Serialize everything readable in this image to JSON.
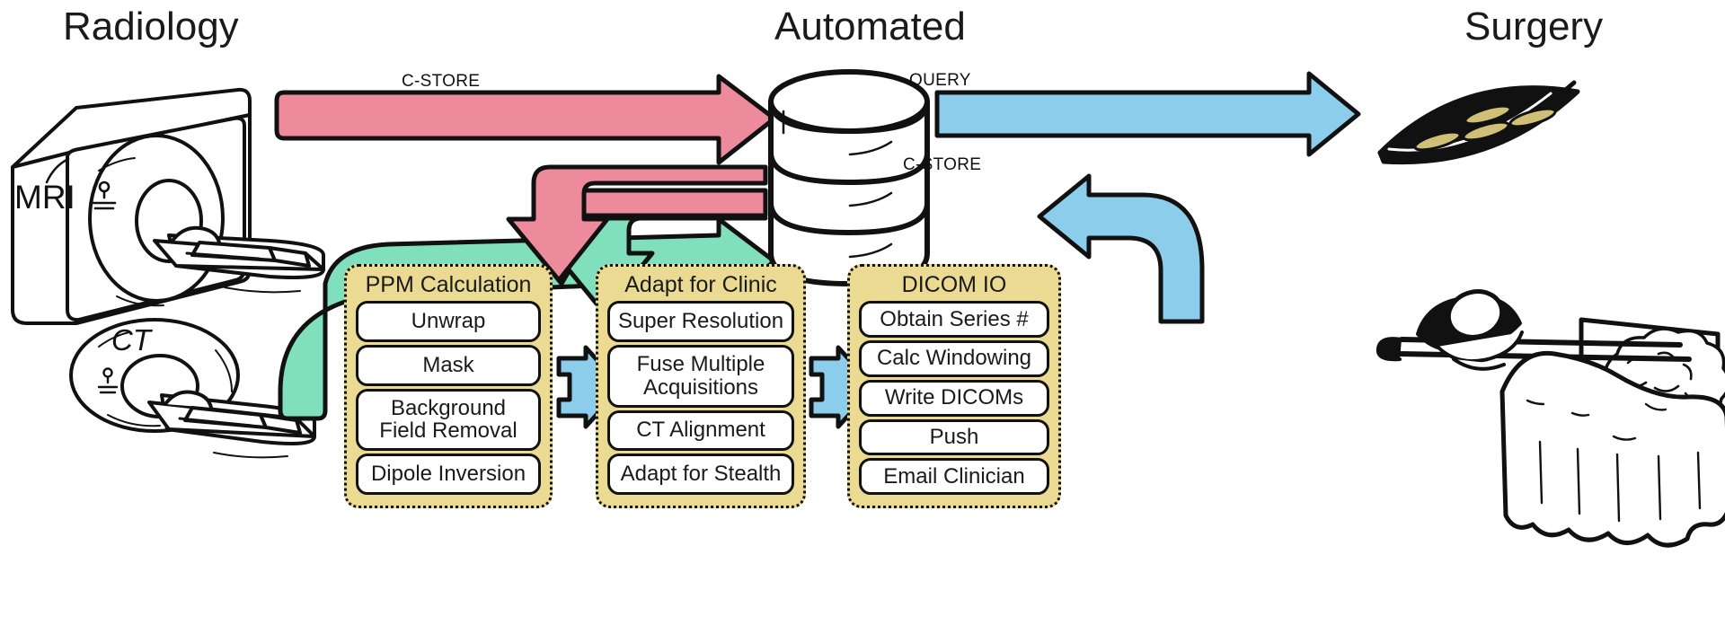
{
  "headings": {
    "radiology": "Radiology",
    "automated": "Automated",
    "surgery": "Surgery"
  },
  "equipment": {
    "mri_label": "MRI",
    "ct_label": "CT"
  },
  "arrow_labels": {
    "cstore_in": "C-STORE",
    "query": "QUERY",
    "cstore_back": "C-STORE"
  },
  "groups": [
    {
      "id": "ppm",
      "title": "PPM Calculation",
      "steps": [
        {
          "label": "Unwrap"
        },
        {
          "label": "Mask"
        },
        {
          "label": "Background\nField Removal"
        },
        {
          "label": "Dipole Inversion"
        }
      ]
    },
    {
      "id": "clinic",
      "title": "Adapt for Clinic",
      "steps": [
        {
          "label": "Super Resolution"
        },
        {
          "label": "Fuse Multiple\nAcquisitions"
        },
        {
          "label": "CT Alignment"
        },
        {
          "label": "Adapt for Stealth"
        }
      ]
    },
    {
      "id": "dicomio",
      "title": "DICOM IO",
      "steps": [
        {
          "label": "Obtain Series #"
        },
        {
          "label": "Calc Windowing"
        },
        {
          "label": "Write DICOMs"
        },
        {
          "label": "Push"
        },
        {
          "label": "Email Clinician"
        }
      ]
    }
  ],
  "icons": {
    "mri_scanner": "mri-scanner-icon",
    "ct_scanner": "ct-scanner-icon",
    "database": "database-cylinder-icon",
    "surgical_light": "surgical-light-icon",
    "brain_monitor": "brain-monitor-icon",
    "patient_table": "patient-on-table-icon",
    "chevron_right": "chevron-right-icon"
  },
  "colors": {
    "pink_flow": "#ED8A9B",
    "green_flow": "#80E0BD",
    "blue_flow": "#8CCDEC",
    "group_fill": "#EBDB92",
    "step_fill": "#FFFFFF",
    "stroke": "#111111",
    "disc_gold": "#CFBF77"
  }
}
